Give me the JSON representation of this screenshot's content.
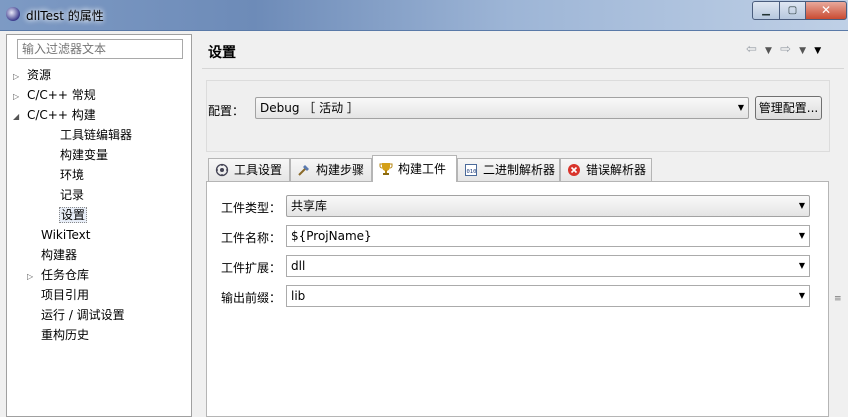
{
  "window": {
    "title": "dllTest 的属性",
    "min_label": "▁",
    "max_label": "▢",
    "close_label": "✕"
  },
  "sidebar": {
    "filter_placeholder": "输入过滤器文本",
    "items": [
      {
        "label": "资源",
        "expandable": true,
        "expanded": false,
        "level": 0
      },
      {
        "label": "C/C++ 常规",
        "expandable": true,
        "expanded": false,
        "level": 0
      },
      {
        "label": "C/C++ 构建",
        "expandable": true,
        "expanded": true,
        "level": 0
      },
      {
        "label": "工具链编辑器",
        "level": 1
      },
      {
        "label": "构建变量",
        "level": 1
      },
      {
        "label": "环境",
        "level": 1
      },
      {
        "label": "记录",
        "level": 1
      },
      {
        "label": "设置",
        "level": 1,
        "selected": true
      },
      {
        "label": "WikiText",
        "level": 0
      },
      {
        "label": "构建器",
        "level": 0
      },
      {
        "label": "任务仓库",
        "expandable": true,
        "expanded": false,
        "level": 0
      },
      {
        "label": "项目引用",
        "level": 0
      },
      {
        "label": "运行 / 调试设置",
        "level": 0
      },
      {
        "label": "重构历史",
        "level": 0
      }
    ]
  },
  "main": {
    "title": "设置",
    "nav": {
      "back": "⇦",
      "forward": "⇨",
      "menu": "▼"
    },
    "config": {
      "label": "配置：",
      "value": "Debug ［ 活动 ］",
      "manage_button": "管理配置..."
    },
    "tabs": [
      {
        "label": "工具设置",
        "icon": "tool-settings-icon",
        "active": false
      },
      {
        "label": "构建步骤",
        "icon": "build-steps-icon",
        "active": false
      },
      {
        "label": "构建工件",
        "icon": "trophy-icon",
        "active": true
      },
      {
        "label": "二进制解析器",
        "icon": "binary-parser-icon",
        "active": false
      },
      {
        "label": "错误解析器",
        "icon": "error-parser-icon",
        "active": false
      }
    ],
    "artifact": {
      "type_label": "工件类型：",
      "type_value": "共享库",
      "name_label": "工件名称：",
      "name_value": "${ProjName}",
      "ext_label": "工件扩展：",
      "ext_value": "dll",
      "prefix_label": "输出前缀：",
      "prefix_value": "lib"
    }
  },
  "colors": {
    "titlebar": "#7d9ac4",
    "close_button": "#c94b32",
    "selection": "#e8eef8"
  }
}
